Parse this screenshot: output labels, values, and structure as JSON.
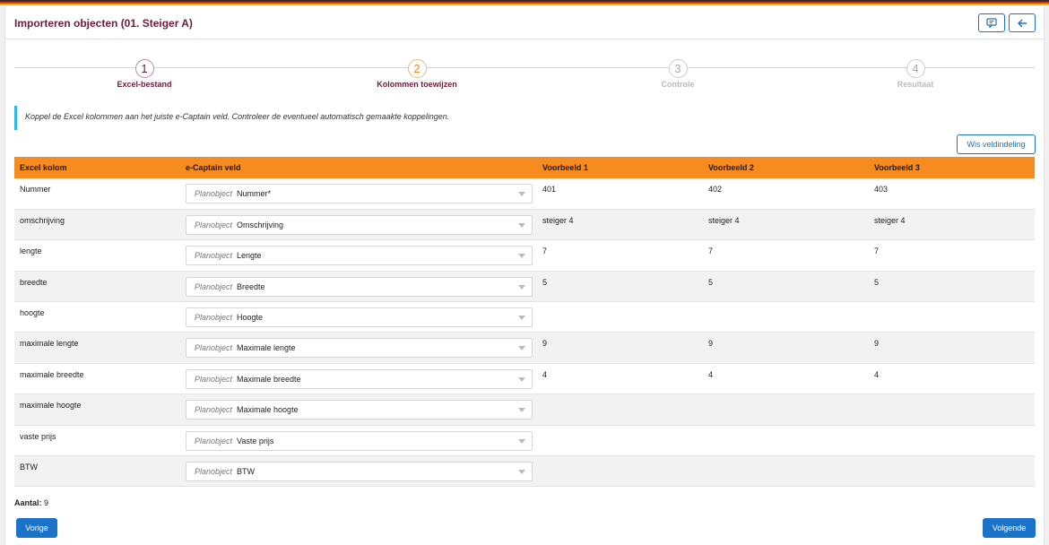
{
  "header": {
    "title": "Importeren objecten (01. Steiger A)",
    "comment_icon": "comment-icon",
    "back_icon": "arrow-left-icon"
  },
  "steps": [
    {
      "number": "1",
      "label": "Excel-bestand",
      "state": "done"
    },
    {
      "number": "2",
      "label": "Kolommen toewijzen",
      "state": "active"
    },
    {
      "number": "3",
      "label": "Controle",
      "state": "pending"
    },
    {
      "number": "4",
      "label": "Resultaat",
      "state": "pending"
    }
  ],
  "info_text": "Koppel de Excel kolommen aan het juiste e-Captain veld. Controleer de eventueel automatisch gemaakte koppelingen.",
  "clear_button": "Wis veldindeling",
  "table": {
    "headers": [
      "Excel kolom",
      "e-Captain veld",
      "Voorbeeld 1",
      "Voorbeeld 2",
      "Voorbeeld 3"
    ],
    "rows": [
      {
        "excel": "Nummer",
        "prefix": "Planobject",
        "field": "Nummer*",
        "v1": "401",
        "v2": "402",
        "v3": "403"
      },
      {
        "excel": "omschrijving",
        "prefix": "Planobject",
        "field": "Omschrijving",
        "v1": "steiger 4",
        "v2": "steiger 4",
        "v3": "steiger 4"
      },
      {
        "excel": "lengte",
        "prefix": "Planobject",
        "field": "Lengte",
        "v1": "7",
        "v2": "7",
        "v3": "7"
      },
      {
        "excel": "breedte",
        "prefix": "Planobject",
        "field": "Breedte",
        "v1": "5",
        "v2": "5",
        "v3": "5"
      },
      {
        "excel": "hoogte",
        "prefix": "Planobject",
        "field": "Hoogte",
        "v1": "",
        "v2": "",
        "v3": ""
      },
      {
        "excel": "maximale lengte",
        "prefix": "Planobject",
        "field": "Maximale lengte",
        "v1": "9",
        "v2": "9",
        "v3": "9"
      },
      {
        "excel": "maximale breedte",
        "prefix": "Planobject",
        "field": "Maximale breedte",
        "v1": "4",
        "v2": "4",
        "v3": "4"
      },
      {
        "excel": "maximale hoogte",
        "prefix": "Planobject",
        "field": "Maximale hoogte",
        "v1": "",
        "v2": "",
        "v3": ""
      },
      {
        "excel": "vaste prijs",
        "prefix": "Planobject",
        "field": "Vaste prijs",
        "v1": "",
        "v2": "",
        "v3": ""
      },
      {
        "excel": "BTW",
        "prefix": "Planobject",
        "field": "BTW",
        "v1": "",
        "v2": "",
        "v3": ""
      }
    ]
  },
  "footer": {
    "count_label": "Aantal:",
    "count_value": "9",
    "prev_button": "Vorige",
    "next_button": "Volgende"
  },
  "colors": {
    "accent": "#1a73c9",
    "header_orange": "#f68c1f",
    "title": "#6d1a3c",
    "info_bar": "#33b6e6"
  }
}
